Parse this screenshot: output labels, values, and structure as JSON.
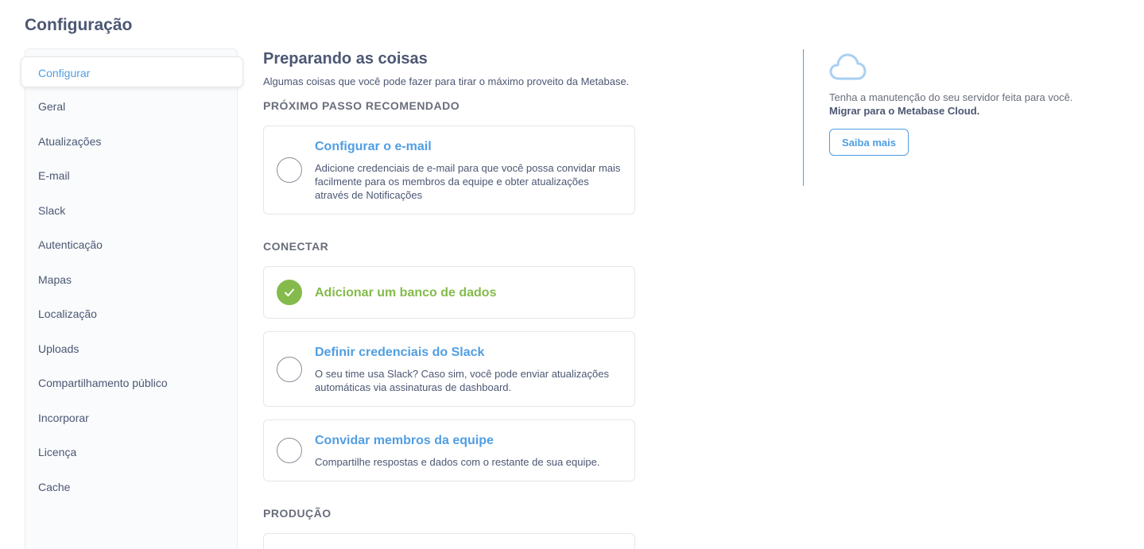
{
  "page": {
    "title": "Configuração"
  },
  "sidebar": {
    "active": "Configurar",
    "items": [
      "Geral",
      "Atualizações",
      "E-mail",
      "Slack",
      "Autenticação",
      "Mapas",
      "Localização",
      "Uploads",
      "Compartilhamento público",
      "Incorporar",
      "Licença",
      "Cache"
    ]
  },
  "main": {
    "title": "Preparando as coisas",
    "subtitle": "Algumas coisas que você pode fazer para tirar o máximo proveito da Metabase.",
    "sections": {
      "recommended": "PRÓXIMO PASSO RECOMENDADO",
      "connect": "CONECTAR",
      "production": "PRODUÇÃO"
    },
    "tasks": {
      "email": {
        "title": "Configurar o e-mail",
        "description": "Adicione credenciais de e-mail para que você possa convidar mais facilmente para os membros da equipe e obter atualizações através de Notificações",
        "done": false
      },
      "database": {
        "title": "Adicionar um banco de dados",
        "done": true
      },
      "slack": {
        "title": "Definir credenciais do Slack",
        "description": "O seu time usa Slack? Caso sim, você pode enviar atualizações automáticas via assinaturas de dashboard.",
        "done": false
      },
      "invite": {
        "title": "Convidar membros da equipe",
        "description": "Compartilhe respostas e dados com o restante de sua equipe.",
        "done": false
      }
    }
  },
  "promo": {
    "icon": "cloud-icon",
    "line1": "Tenha a manutenção do seu servidor feita para você.",
    "line2": "Migrar para o Metabase Cloud.",
    "button": "Saiba mais"
  },
  "colors": {
    "brand": "#509ee3",
    "success": "#84bb4c",
    "text": "#4c5773"
  }
}
